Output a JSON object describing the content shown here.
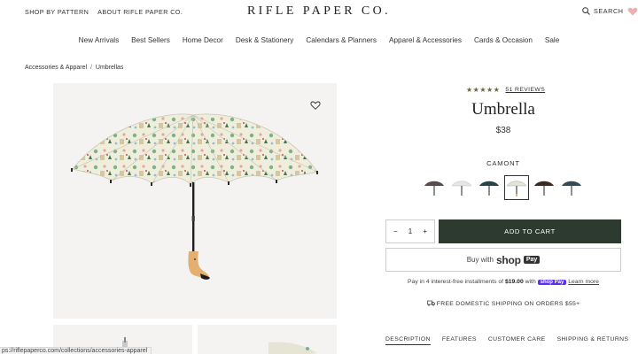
{
  "header": {
    "top_links": [
      "SHOP BY PATTERN",
      "ABOUT RIFLE PAPER CO."
    ],
    "logo": "RIFLE PAPER CO.",
    "search_label": "SEARCH",
    "heart_icon": "heart-icon"
  },
  "nav": [
    "New Arrivals",
    "Best Sellers",
    "Home Decor",
    "Desk & Stationery",
    "Calendars & Planners",
    "Apparel & Accessories",
    "Cards & Occasion",
    "Sale"
  ],
  "breadcrumb": {
    "parent": "Accessories & Apparel",
    "separator": "/",
    "current": "Umbrellas"
  },
  "product": {
    "rating_stars": "★★★★★",
    "rating_value": 5,
    "reviews_label": "51 REVIEWS",
    "title": "Umbrella",
    "price": "$38",
    "variant_name": "CAMONT",
    "swatches": [
      {
        "canopy": "#5a4a4a",
        "selected": false
      },
      {
        "canopy": "#e8e6e2",
        "selected": false
      },
      {
        "canopy": "#24464a",
        "selected": false
      },
      {
        "canopy": "#dfe6d6",
        "selected": true
      },
      {
        "canopy": "#3b2a22",
        "selected": false
      },
      {
        "canopy": "#334a58",
        "selected": false
      }
    ],
    "quantity": "1",
    "qty_minus": "−",
    "qty_plus": "+",
    "add_to_cart": "ADD TO CART",
    "shoppay_prefix": "Buy with",
    "shoppay_shop": "shop",
    "shoppay_pay": "Pay",
    "installments_text": "Pay in 4 interest-free installments of",
    "installments_amount": "$19.00",
    "installments_with": "with",
    "installments_shop": "shop Pay",
    "learn_more": "Learn more",
    "shipping": "FREE DOMESTIC SHIPPING ON ORDERS $55+"
  },
  "tabs": [
    "DESCRIPTION",
    "FEATURES",
    "CUSTOMER CARE",
    "SHIPPING & RETURNS"
  ],
  "status_url": "ps://riflepaperco.com/collections/accessories-apparel",
  "colors": {
    "primary_button": "#2c3a2f",
    "stars": "#6b6342",
    "image_bg": "#f4f3f1"
  }
}
